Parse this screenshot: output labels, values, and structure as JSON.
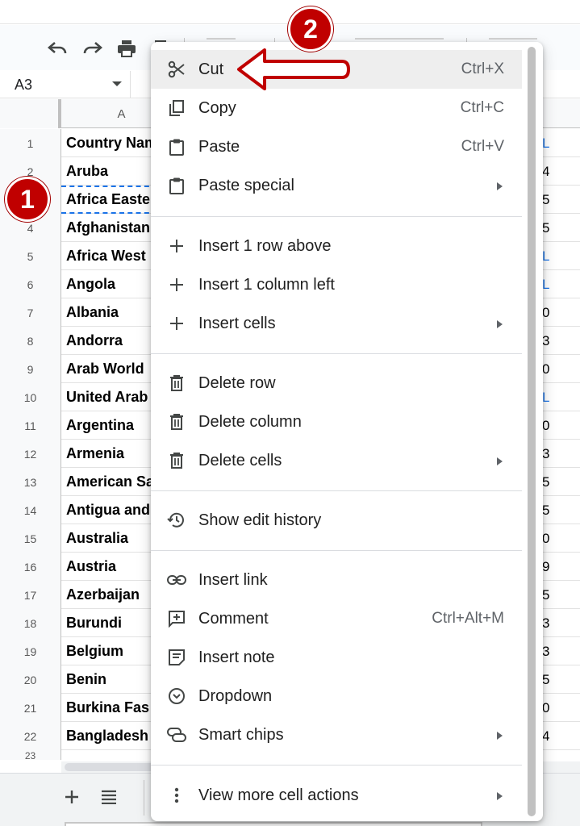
{
  "name_box": {
    "value": "A3"
  },
  "column_header": {
    "label": "A"
  },
  "rows": [
    {
      "num": "1",
      "a": "Country Nam",
      "right": "L",
      "right_blue": true
    },
    {
      "num": "2",
      "a": "Aruba",
      "right": "4",
      "right_blue": false
    },
    {
      "num": "3",
      "a": "Africa Easte",
      "right": "5",
      "right_blue": false
    },
    {
      "num": "4",
      "a": "Afghanistan",
      "right": "5",
      "right_blue": false
    },
    {
      "num": "5",
      "a": "Africa West",
      "right": "L",
      "right_blue": true
    },
    {
      "num": "6",
      "a": "Angola",
      "right": "L",
      "right_blue": true
    },
    {
      "num": "7",
      "a": "Albania",
      "right": "0",
      "right_blue": false
    },
    {
      "num": "8",
      "a": "Andorra",
      "right": "3",
      "right_blue": false
    },
    {
      "num": "9",
      "a": "Arab World",
      "right": "0",
      "right_blue": false
    },
    {
      "num": "10",
      "a": "United Arab",
      "right": "L",
      "right_blue": true
    },
    {
      "num": "11",
      "a": "Argentina",
      "right": "0",
      "right_blue": false
    },
    {
      "num": "12",
      "a": "Armenia",
      "right": "3",
      "right_blue": false
    },
    {
      "num": "13",
      "a": "American Sa",
      "right": "5",
      "right_blue": false
    },
    {
      "num": "14",
      "a": "Antigua and",
      "right": "5",
      "right_blue": false
    },
    {
      "num": "15",
      "a": "Australia",
      "right": "0",
      "right_blue": false
    },
    {
      "num": "16",
      "a": "Austria",
      "right": "9",
      "right_blue": false
    },
    {
      "num": "17",
      "a": "Azerbaijan",
      "right": "5",
      "right_blue": false
    },
    {
      "num": "18",
      "a": "Burundi",
      "right": "3",
      "right_blue": false
    },
    {
      "num": "19",
      "a": "Belgium",
      "right": "3",
      "right_blue": false
    },
    {
      "num": "20",
      "a": "Benin",
      "right": "5",
      "right_blue": false
    },
    {
      "num": "21",
      "a": "Burkina Fas",
      "right": "0",
      "right_blue": false
    },
    {
      "num": "22",
      "a": "Bangladesh",
      "right": "4",
      "right_blue": false
    }
  ],
  "partial_row_num": "23",
  "menu": {
    "cut": {
      "label": "Cut",
      "shortcut": "Ctrl+X",
      "icon": "scissors-icon"
    },
    "copy": {
      "label": "Copy",
      "shortcut": "Ctrl+C",
      "icon": "copy-icon"
    },
    "paste": {
      "label": "Paste",
      "shortcut": "Ctrl+V",
      "icon": "clipboard-icon"
    },
    "paste_special": {
      "label": "Paste special",
      "icon": "clipboard-icon"
    },
    "insert_row": {
      "label": "Insert 1 row above",
      "icon": "plus-icon"
    },
    "insert_col": {
      "label": "Insert 1 column left",
      "icon": "plus-icon"
    },
    "insert_cells": {
      "label": "Insert cells",
      "icon": "plus-icon"
    },
    "delete_row": {
      "label": "Delete row",
      "icon": "trash-icon"
    },
    "delete_col": {
      "label": "Delete column",
      "icon": "trash-icon"
    },
    "delete_cells": {
      "label": "Delete cells",
      "icon": "trash-icon"
    },
    "edit_history": {
      "label": "Show edit history",
      "icon": "history-icon"
    },
    "insert_link": {
      "label": "Insert link",
      "icon": "link-icon"
    },
    "comment": {
      "label": "Comment",
      "shortcut": "Ctrl+Alt+M",
      "icon": "comment-add-icon"
    },
    "insert_note": {
      "label": "Insert note",
      "icon": "note-icon"
    },
    "dropdown": {
      "label": "Dropdown",
      "icon": "dropdown-icon"
    },
    "smart_chips": {
      "label": "Smart chips",
      "icon": "chips-icon"
    },
    "more_actions": {
      "label": "View more cell actions",
      "icon": "more-vert-icon"
    }
  },
  "annotations": {
    "badge_1": "1",
    "badge_2": "2"
  },
  "colors": {
    "badge": "#c00000",
    "selection": "#1a73e8",
    "hover": "#eeeeee"
  }
}
